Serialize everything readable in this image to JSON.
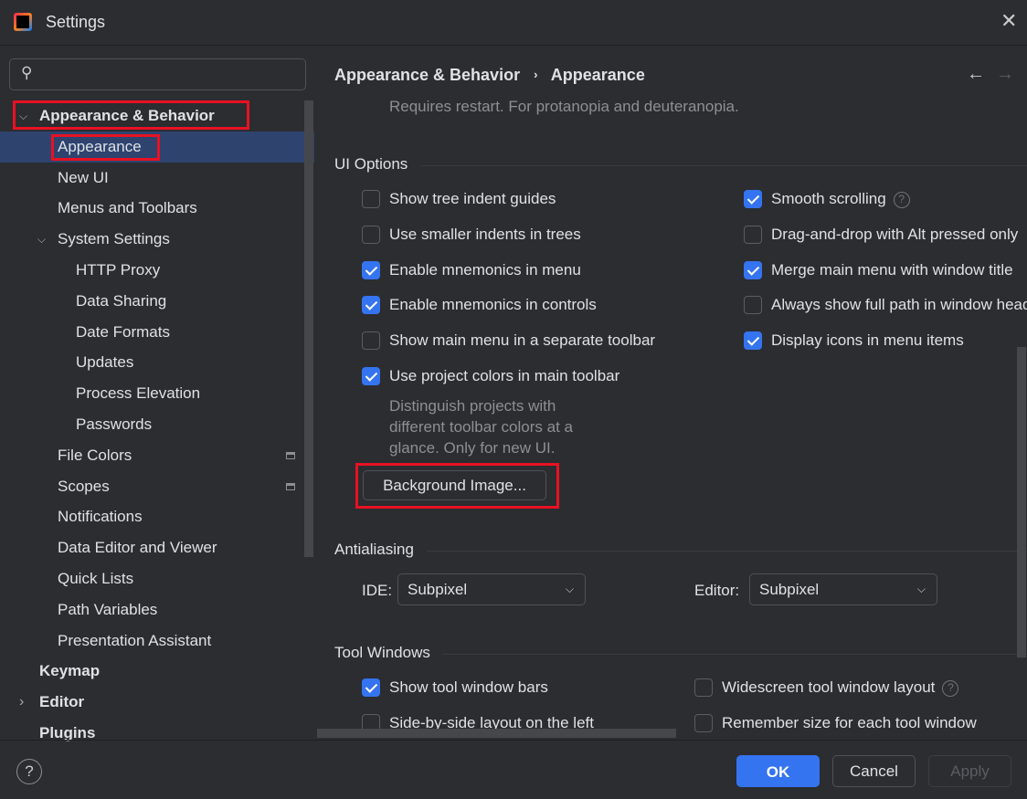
{
  "window": {
    "title": "Settings",
    "close_icon": "close-icon"
  },
  "search": {
    "placeholder": ""
  },
  "sidebar": {
    "items": [
      {
        "label": "Appearance & Behavior",
        "level": 0,
        "bold": true,
        "expanded": true
      },
      {
        "label": "Appearance",
        "level": 1,
        "selected": true
      },
      {
        "label": "New UI",
        "level": 1
      },
      {
        "label": "Menus and Toolbars",
        "level": 1
      },
      {
        "label": "System Settings",
        "level": 1,
        "expanded": true
      },
      {
        "label": "HTTP Proxy",
        "level": 2
      },
      {
        "label": "Data Sharing",
        "level": 2
      },
      {
        "label": "Date Formats",
        "level": 2
      },
      {
        "label": "Updates",
        "level": 2
      },
      {
        "label": "Process Elevation",
        "level": 2
      },
      {
        "label": "Passwords",
        "level": 2
      },
      {
        "label": "File Colors",
        "level": 1,
        "project_icon": true
      },
      {
        "label": "Scopes",
        "level": 1,
        "project_icon": true
      },
      {
        "label": "Notifications",
        "level": 1
      },
      {
        "label": "Data Editor and Viewer",
        "level": 1
      },
      {
        "label": "Quick Lists",
        "level": 1
      },
      {
        "label": "Path Variables",
        "level": 1
      },
      {
        "label": "Presentation Assistant",
        "level": 1
      },
      {
        "label": "Keymap",
        "level": 0,
        "bold": true
      },
      {
        "label": "Editor",
        "level": 0,
        "bold": true,
        "collapsed": true
      },
      {
        "label": "Plugins",
        "level": 0,
        "bold": true
      }
    ]
  },
  "breadcrumb": {
    "parent": "Appearance & Behavior",
    "current": "Appearance"
  },
  "main": {
    "restart_note": "Requires restart. For protanopia and deuteranopia.",
    "ui_options": {
      "title": "UI Options",
      "left": [
        {
          "label": "Show tree indent guides",
          "checked": false
        },
        {
          "label": "Use smaller indents in trees",
          "checked": false
        },
        {
          "label": "Enable mnemonics in menu",
          "checked": true
        },
        {
          "label": "Enable mnemonics in controls",
          "checked": true
        },
        {
          "label": "Show main menu in a separate toolbar",
          "checked": false
        },
        {
          "label": "Use project colors in main toolbar",
          "checked": true
        }
      ],
      "right": [
        {
          "label": "Smooth scrolling",
          "checked": true,
          "help": true
        },
        {
          "label": "Drag-and-drop with Alt pressed only",
          "checked": false
        },
        {
          "label": "Merge main menu with window title",
          "checked": true
        },
        {
          "label": "Always show full path in window header",
          "checked": false
        },
        {
          "label": "Display icons in menu items",
          "checked": true
        }
      ],
      "project_colors_hint": [
        "Distinguish projects with",
        "different toolbar colors at a",
        "glance. Only for new UI."
      ],
      "background_button": "Background Image..."
    },
    "antialiasing": {
      "title": "Antialiasing",
      "ide_label": "IDE:",
      "ide_value": "Subpixel",
      "editor_label": "Editor:",
      "editor_value": "Subpixel"
    },
    "tool_windows": {
      "title": "Tool Windows",
      "items": [
        {
          "label": "Show tool window bars",
          "checked": true
        },
        {
          "label": "Widescreen tool window layout",
          "checked": false,
          "help": true
        },
        {
          "label": "Side-by-side layout on the left",
          "checked": false
        },
        {
          "label": "Remember size for each tool window",
          "checked": false
        }
      ]
    }
  },
  "footer": {
    "help": "?",
    "ok": "OK",
    "cancel": "Cancel",
    "apply": "Apply"
  },
  "colors": {
    "accent": "#3574f0",
    "highlight_box": "#e81123",
    "selection": "#2e436e",
    "background": "#2b2d30"
  }
}
